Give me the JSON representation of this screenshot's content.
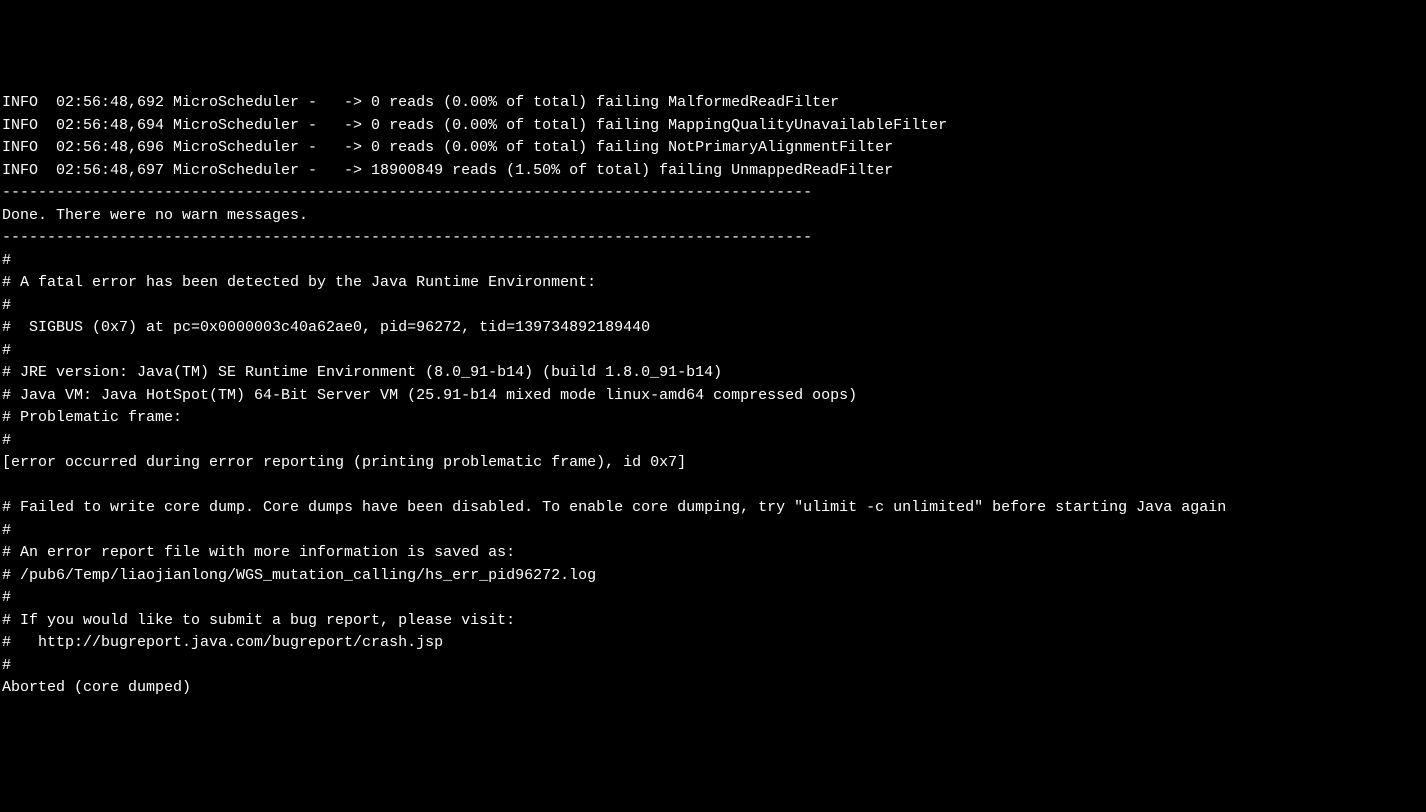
{
  "lines": [
    "INFO  02:56:48,692 MicroScheduler -   -> 0 reads (0.00% of total) failing MalformedReadFilter",
    "INFO  02:56:48,694 MicroScheduler -   -> 0 reads (0.00% of total) failing MappingQualityUnavailableFilter",
    "INFO  02:56:48,696 MicroScheduler -   -> 0 reads (0.00% of total) failing NotPrimaryAlignmentFilter",
    "INFO  02:56:48,697 MicroScheduler -   -> 18900849 reads (1.50% of total) failing UnmappedReadFilter",
    "------------------------------------------------------------------------------------------",
    "Done. There were no warn messages.",
    "------------------------------------------------------------------------------------------",
    "#",
    "# A fatal error has been detected by the Java Runtime Environment:",
    "#",
    "#  SIGBUS (0x7) at pc=0x0000003c40a62ae0, pid=96272, tid=139734892189440",
    "#",
    "# JRE version: Java(TM) SE Runtime Environment (8.0_91-b14) (build 1.8.0_91-b14)",
    "# Java VM: Java HotSpot(TM) 64-Bit Server VM (25.91-b14 mixed mode linux-amd64 compressed oops)",
    "# Problematic frame:",
    "#",
    "[error occurred during error reporting (printing problematic frame), id 0x7]",
    "",
    "# Failed to write core dump. Core dumps have been disabled. To enable core dumping, try \"ulimit -c unlimited\" before starting Java again",
    "#",
    "# An error report file with more information is saved as:",
    "# /pub6/Temp/liaojianlong/WGS_mutation_calling/hs_err_pid96272.log",
    "#",
    "# If you would like to submit a bug report, please visit:",
    "#   http://bugreport.java.com/bugreport/crash.jsp",
    "#",
    "Aborted (core dumped)"
  ]
}
